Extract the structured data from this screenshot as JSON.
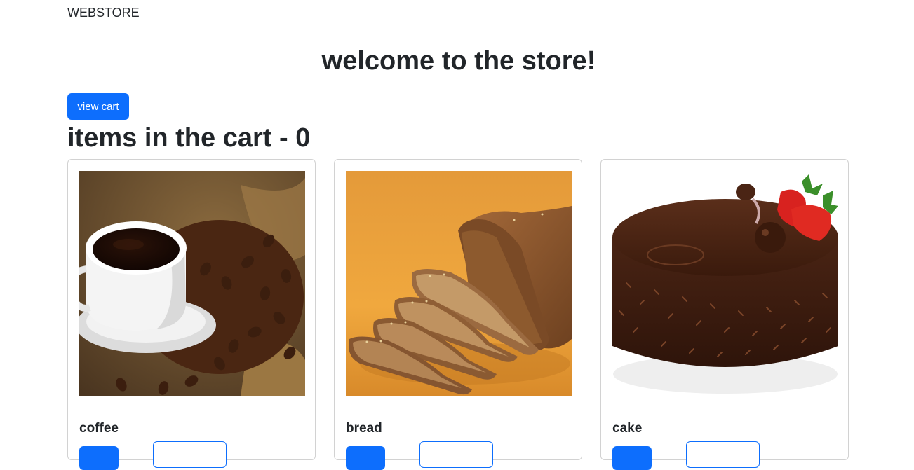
{
  "navbar": {
    "brand": "WEBSTORE"
  },
  "header": {
    "title": "welcome to the store!"
  },
  "cart": {
    "view_button_label": "view cart",
    "count_text": "items in the cart - 0"
  },
  "products": [
    {
      "name": "coffee",
      "image": "coffee-cup-with-beans-photo",
      "add_label": "",
      "details_label": ""
    },
    {
      "name": "bread",
      "image": "sliced-bread-loaf-photo",
      "add_label": "",
      "details_label": ""
    },
    {
      "name": "cake",
      "image": "chocolate-cake-with-strawberries-photo",
      "add_label": "",
      "details_label": ""
    }
  ],
  "colors": {
    "primary": "#0d6efd",
    "text": "#212529",
    "card_border": "#dee2e6"
  }
}
